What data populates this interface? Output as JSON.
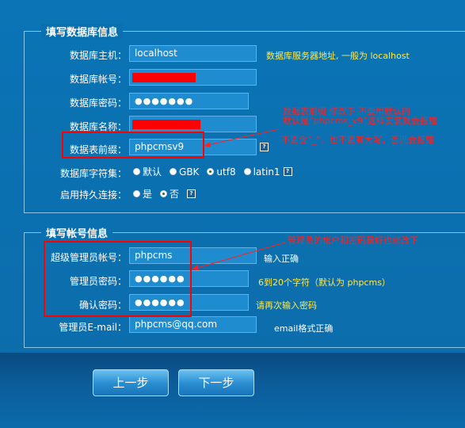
{
  "db_section": {
    "title": "填写数据库信息",
    "fields": [
      {
        "label": "数据库主机：",
        "value": "localhost",
        "hint": "数据库服务器地址, 一般为 localhost"
      },
      {
        "label": "数据库帐号：",
        "value": ""
      },
      {
        "label": "数据库密码：",
        "value": "●●●●●●●"
      },
      {
        "label": "数据库名称：",
        "value": ""
      },
      {
        "label": "数据表前缀：",
        "value": "phpcmsv9",
        "help": "?"
      }
    ],
    "charset": {
      "label": "数据库字符集：",
      "options": [
        "默认",
        "GBK",
        "utf8",
        "latin1"
      ],
      "selected": "utf8",
      "help": "?"
    },
    "persistent": {
      "label": "启用持久连接：",
      "options": [
        "是",
        "否"
      ],
      "selected": "否",
      "help": "?"
    }
  },
  "admin_section": {
    "title": "填写帐号信息",
    "fields": [
      {
        "label": "超级管理员帐号：",
        "value": "phpcms",
        "hint": "输入正确"
      },
      {
        "label": "管理员密码：",
        "value": "●●●●●●",
        "hint": "6到20个字符（默认为 phpcms）"
      },
      {
        "label": "确认密码：",
        "value": "●●●●●●",
        "hint": "请再次输入密码"
      },
      {
        "label": "管理员E-mail：",
        "value": "phpcms@qq.com",
        "hint": "email格式正确"
      }
    ]
  },
  "annotations": {
    "prefix_note_1": "数据表前缀 修改下 不要用默认的",
    "prefix_note_2": "默认是“phpcms_v9”这样安装就会报错",
    "prefix_note_3": "不要含“_”，也不要有大写，否则会报错",
    "admin_note": "管理员的帐户和密码最好也修改下"
  },
  "buttons": {
    "prev": "上一步",
    "next": "下一步"
  },
  "colors": {
    "background": "#0b6fae",
    "hint": "#ffe94a",
    "annotation": "#ff2020",
    "redaction": "#ff0000"
  }
}
